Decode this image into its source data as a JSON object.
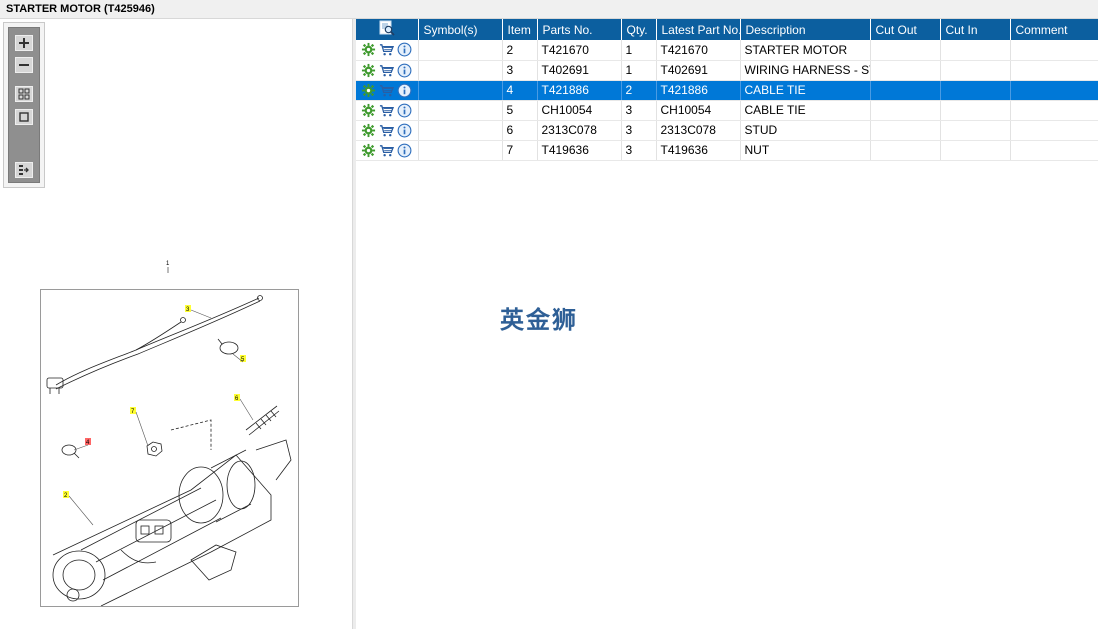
{
  "title": "STARTER MOTOR (T425946)",
  "toolbox": {
    "buttons": [
      "zoom-in",
      "zoom-out",
      "fit-all",
      "actual-size",
      "export"
    ]
  },
  "diagram": {
    "assembly_callout": "1",
    "callouts": [
      {
        "label": "2",
        "highlight": "yellow"
      },
      {
        "label": "3",
        "highlight": "yellow"
      },
      {
        "label": "4",
        "highlight": "red"
      },
      {
        "label": "5",
        "highlight": "yellow"
      },
      {
        "label": "6",
        "highlight": "yellow"
      },
      {
        "label": "7",
        "highlight": "yellow"
      }
    ]
  },
  "table": {
    "columns": [
      "",
      "Symbol(s)",
      "Item",
      "Parts No.",
      "Qty.",
      "Latest Part No.",
      "Description",
      "Cut Out",
      "Cut In",
      "Comment"
    ],
    "rows": [
      {
        "item": "2",
        "parts_no": "T421670",
        "qty": "1",
        "latest": "T421670",
        "description": "STARTER MOTOR",
        "selected": false
      },
      {
        "item": "3",
        "parts_no": "T402691",
        "qty": "1",
        "latest": "T402691",
        "description": "WIRING HARNESS - STAR",
        "selected": false
      },
      {
        "item": "4",
        "parts_no": "T421886",
        "qty": "2",
        "latest": "T421886",
        "description": "CABLE TIE",
        "selected": true
      },
      {
        "item": "5",
        "parts_no": "CH10054",
        "qty": "3",
        "latest": "CH10054",
        "description": "CABLE TIE",
        "selected": false
      },
      {
        "item": "6",
        "parts_no": "2313C078",
        "qty": "3",
        "latest": "2313C078",
        "description": "STUD",
        "selected": false
      },
      {
        "item": "7",
        "parts_no": "T419636",
        "qty": "3",
        "latest": "T419636",
        "description": "NUT",
        "selected": false
      }
    ]
  },
  "watermark": "英金狮",
  "colors": {
    "header_bg": "#0c5f9f",
    "selected_row": "#0078d7",
    "callout_yellow": "#ffff33",
    "callout_red": "#ff6666",
    "watermark": "#2e5f96"
  }
}
